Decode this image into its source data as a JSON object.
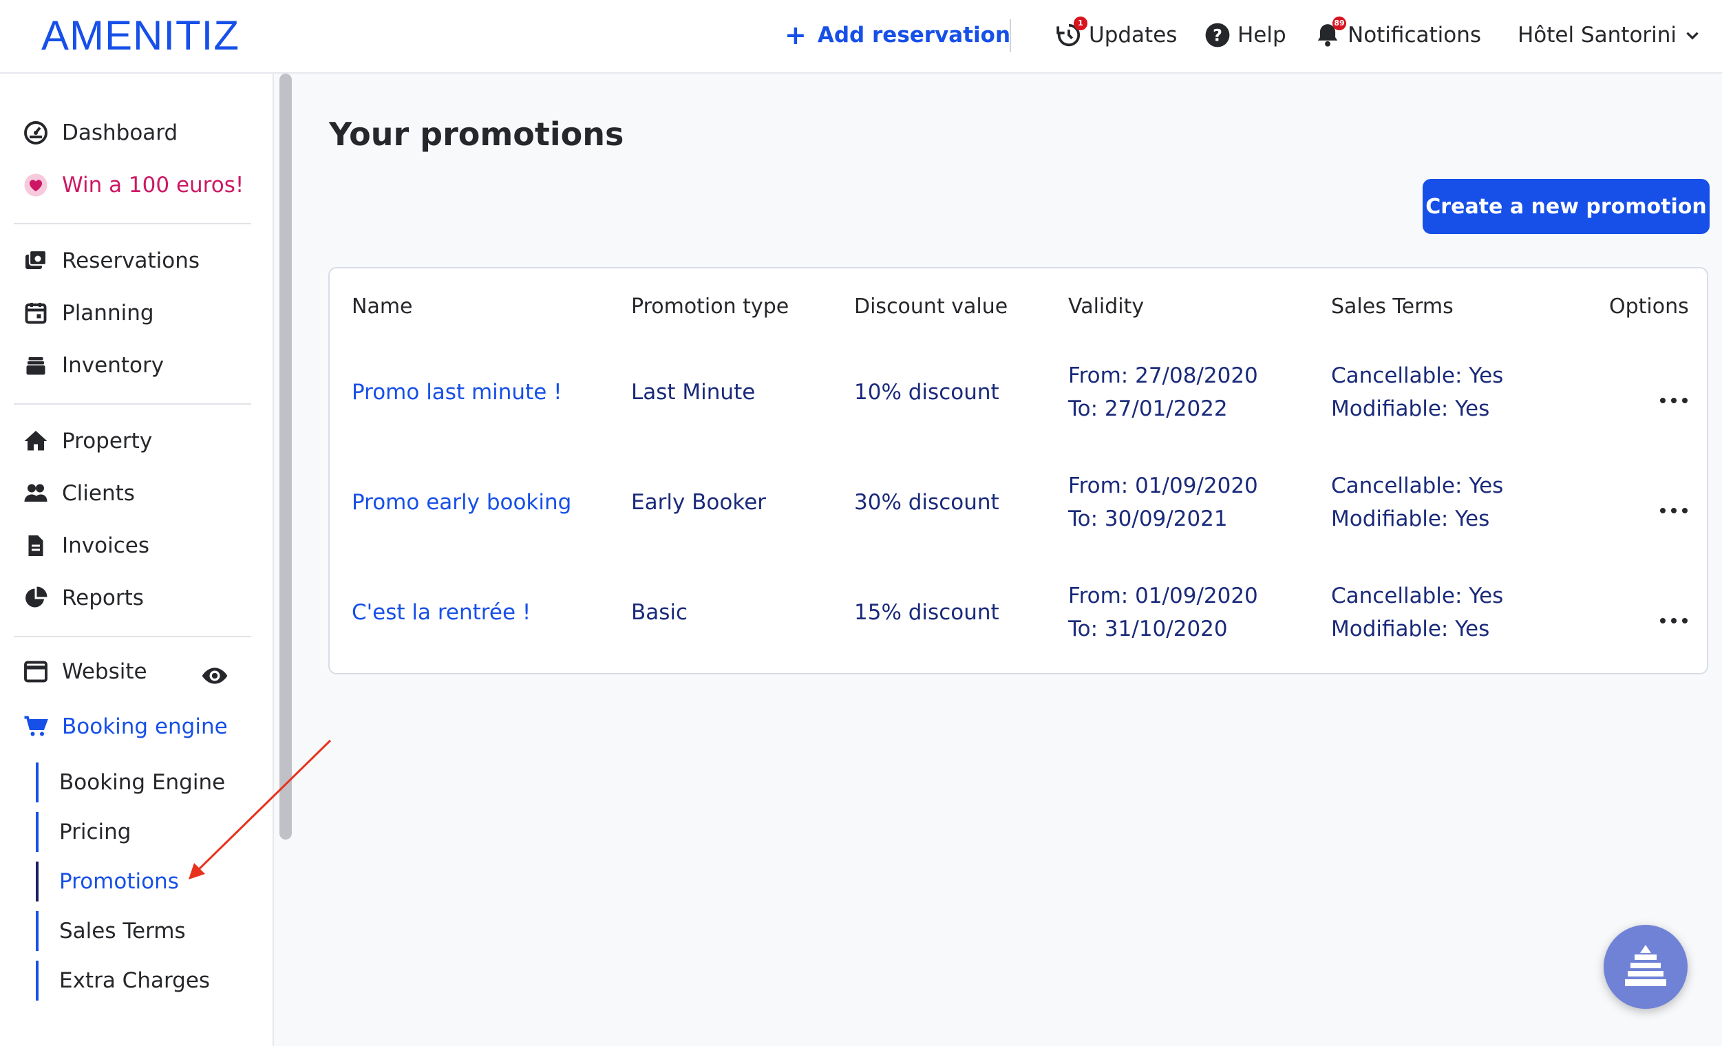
{
  "header": {
    "logo": "AMENITIZ",
    "add_reservation": "Add reservation",
    "updates": "Updates",
    "updates_badge": "1",
    "help": "Help",
    "notifications": "Notifications",
    "notifications_badge": "89",
    "hotel": "Hôtel Santorini"
  },
  "sidebar": {
    "items": [
      {
        "label": "Dashboard",
        "icon": "dashboard-gauge-icon"
      },
      {
        "label": "Win a 100 euros!",
        "icon": "heart-icon"
      },
      {
        "label": "Reservations",
        "icon": "reservations-icon"
      },
      {
        "label": "Planning",
        "icon": "calendar-icon"
      },
      {
        "label": "Inventory",
        "icon": "inventory-stack-icon"
      },
      {
        "label": "Property",
        "icon": "home-icon"
      },
      {
        "label": "Clients",
        "icon": "users-icon"
      },
      {
        "label": "Invoices",
        "icon": "invoice-document-icon"
      },
      {
        "label": "Reports",
        "icon": "pie-chart-icon"
      },
      {
        "label": "Website",
        "icon": "browser-window-icon"
      },
      {
        "label": "Booking engine",
        "icon": "shopping-cart-icon"
      }
    ],
    "submenu": [
      {
        "label": "Booking Engine"
      },
      {
        "label": "Pricing"
      },
      {
        "label": "Promotions"
      },
      {
        "label": "Sales Terms"
      },
      {
        "label": "Extra Charges"
      }
    ]
  },
  "main": {
    "title": "Your promotions",
    "create_button": "Create a new promotion",
    "table": {
      "columns": [
        "Name",
        "Promotion type",
        "Discount value",
        "Validity",
        "Sales Terms",
        "Options"
      ],
      "rows": [
        {
          "name": "Promo last minute !",
          "type": "Last Minute",
          "discount": "10% discount",
          "from": "From: 27/08/2020",
          "to": "To: 27/01/2022",
          "cancellable": "Cancellable: Yes",
          "modifiable": "Modifiable: Yes"
        },
        {
          "name": "Promo early booking",
          "type": "Early Booker",
          "discount": "30% discount",
          "from": "From: 01/09/2020",
          "to": "To: 30/09/2021",
          "cancellable": "Cancellable: Yes",
          "modifiable": "Modifiable: Yes"
        },
        {
          "name": "C'est la rentrée !",
          "type": "Basic",
          "discount": "15% discount",
          "from": "From: 01/09/2020",
          "to": "To: 31/10/2020",
          "cancellable": "Cancellable: Yes",
          "modifiable": "Modifiable: Yes"
        }
      ]
    }
  },
  "colors": {
    "brand": "#1750e8",
    "accent_pink": "#cc1864",
    "text_dark_blue": "#1a2a7a",
    "annotation_red": "#e8321e"
  }
}
